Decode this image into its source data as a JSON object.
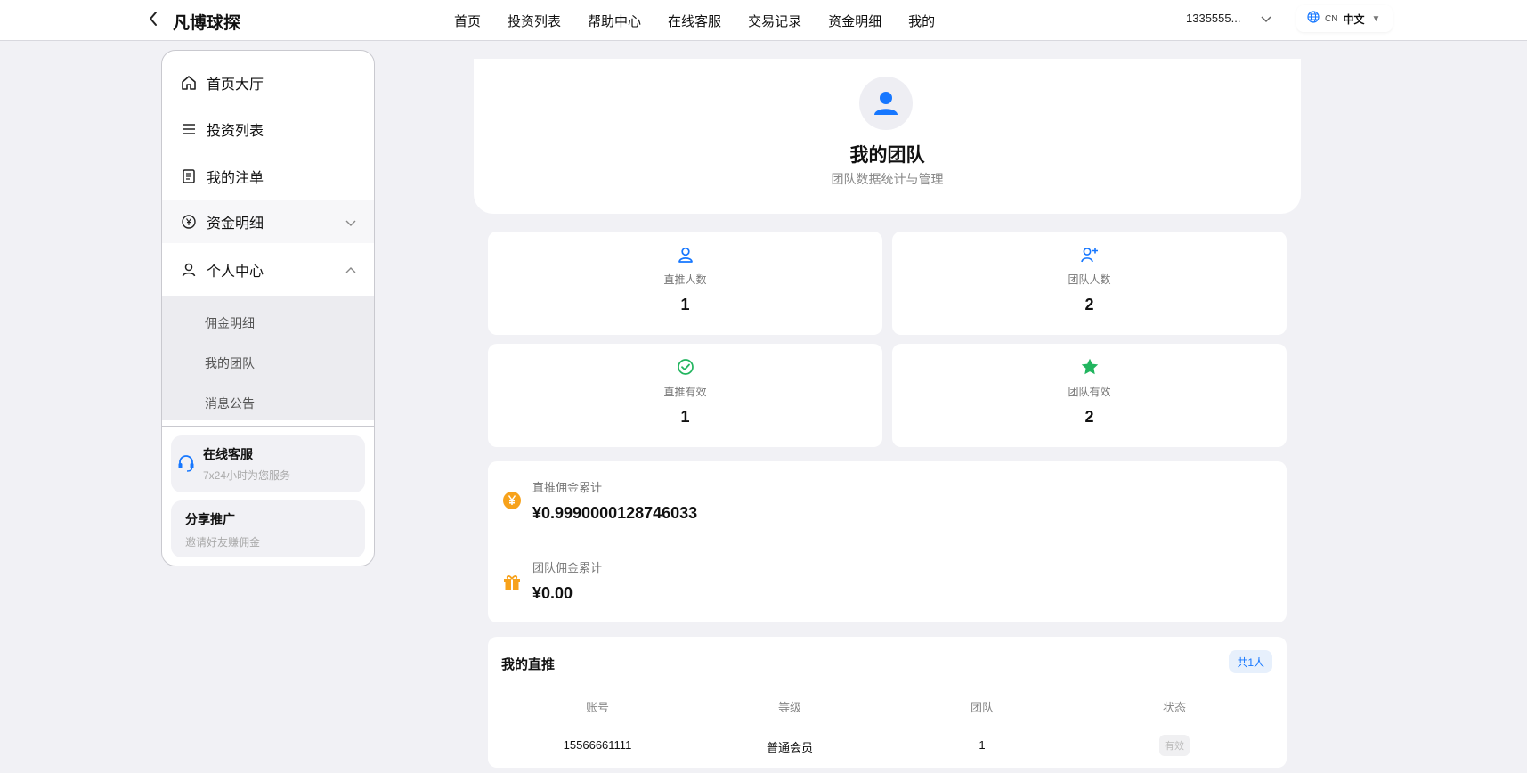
{
  "header": {
    "brand": "凡博球探",
    "nav": [
      "首页",
      "投资列表",
      "帮助中心",
      "在线客服",
      "交易记录",
      "资金明细",
      "我的"
    ],
    "account": "1335555...",
    "lang_code": "CN",
    "lang_label": "中文"
  },
  "sidebar": {
    "items": [
      {
        "label": "首页大厅",
        "icon": "home-icon"
      },
      {
        "label": "投资列表",
        "icon": "list-icon"
      },
      {
        "label": "我的注单",
        "icon": "document-icon"
      },
      {
        "label": "资金明细",
        "icon": "yen-circle-icon"
      },
      {
        "label": "个人中心",
        "icon": "user-icon"
      }
    ],
    "subitems": [
      "佣金明细",
      "我的团队",
      "消息公告"
    ],
    "service": {
      "title": "在线客服",
      "subtitle": "7x24小时为您服务"
    },
    "share": {
      "title": "分享推广",
      "subtitle": "邀请好友赚佣金"
    }
  },
  "hero": {
    "title": "我的团队",
    "subtitle": "团队数据统计与管理"
  },
  "stats": [
    {
      "label": "直推人数",
      "value": "1",
      "icon": "user-icon",
      "color": "#1677ff"
    },
    {
      "label": "团队人数",
      "value": "2",
      "icon": "user-plus-icon",
      "color": "#1677ff"
    },
    {
      "label": "直推有效",
      "value": "1",
      "icon": "check-circle-icon",
      "color": "#22b55f"
    },
    {
      "label": "团队有效",
      "value": "2",
      "icon": "star-icon",
      "color": "#22b55f"
    }
  ],
  "commission": {
    "direct_label": "直推佣金累计",
    "direct_value": "¥0.9990000128746033",
    "team_label": "团队佣金累计",
    "team_value": "¥0.00"
  },
  "direct_list": {
    "title": "我的直推",
    "count": "共1人",
    "columns": [
      "账号",
      "等级",
      "团队",
      "状态"
    ],
    "rows": [
      [
        "15566661111",
        "普通会员",
        "1",
        "有效"
      ]
    ]
  },
  "colors": {
    "accent": "#1677ff",
    "success": "#22b55f",
    "orange": "#f7a21b"
  }
}
